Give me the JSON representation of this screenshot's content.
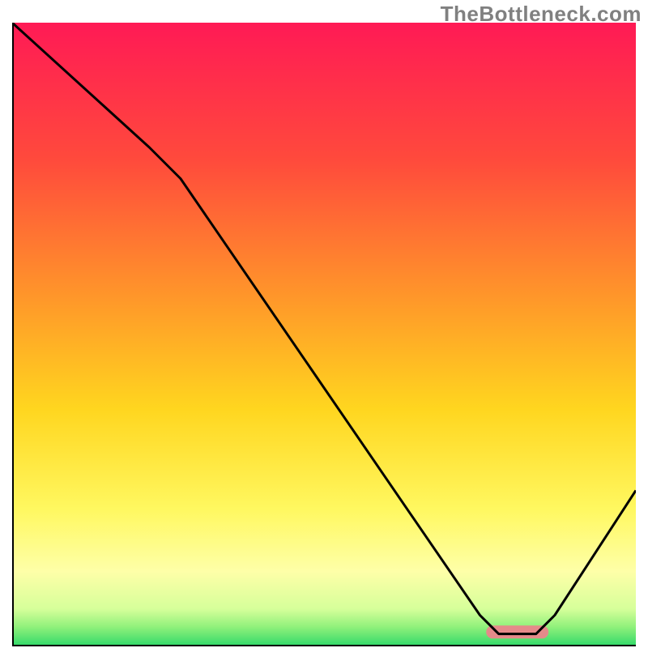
{
  "watermark": "TheBottleneck.com",
  "chart_data": {
    "type": "line",
    "title": "",
    "xlabel": "",
    "ylabel": "",
    "xlim": [
      0,
      100
    ],
    "ylim": [
      0,
      100
    ],
    "grid": false,
    "legend": false,
    "gradient_stops": [
      {
        "offset": 0,
        "color": "#ff1a55"
      },
      {
        "offset": 22,
        "color": "#ff4a3c"
      },
      {
        "offset": 45,
        "color": "#ff9a29"
      },
      {
        "offset": 62,
        "color": "#ffd61f"
      },
      {
        "offset": 78,
        "color": "#fff860"
      },
      {
        "offset": 88,
        "color": "#feffa8"
      },
      {
        "offset": 94,
        "color": "#d6ff9a"
      },
      {
        "offset": 97,
        "color": "#8df07a"
      },
      {
        "offset": 100,
        "color": "#2fd96a"
      }
    ],
    "series": [
      {
        "name": "curve",
        "points": [
          {
            "x": 0,
            "y": 100
          },
          {
            "x": 22,
            "y": 80
          },
          {
            "x": 27,
            "y": 75
          },
          {
            "x": 75,
            "y": 5
          },
          {
            "x": 78,
            "y": 2
          },
          {
            "x": 84,
            "y": 2
          },
          {
            "x": 87,
            "y": 5
          },
          {
            "x": 100,
            "y": 25
          }
        ]
      }
    ],
    "marker": {
      "x_start": 76,
      "x_end": 86,
      "y": 2.3,
      "color": "#e58a8a"
    },
    "axes_color": "#000000",
    "curve_color": "#000000"
  }
}
